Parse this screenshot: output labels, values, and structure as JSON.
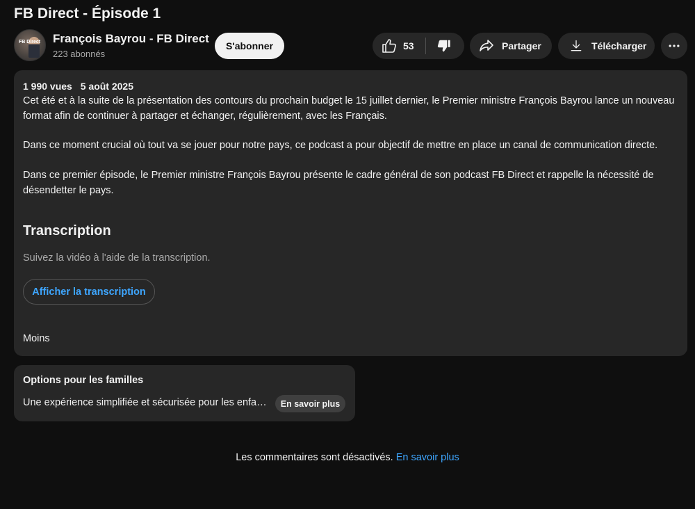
{
  "video": {
    "title": "FB Direct - Épisode 1"
  },
  "channel": {
    "avatar_text": "FB Direct",
    "name": "François Bayrou - FB Direct",
    "subscribers": "223 abonnés",
    "subscribe_label": "S'abonner"
  },
  "actions": {
    "like_count": "53",
    "share_label": "Partager",
    "download_label": "Télécharger",
    "icons": [
      "thumbs-up-icon",
      "thumbs-down-icon",
      "share-arrow-icon",
      "download-icon",
      "more-horizontal-icon"
    ]
  },
  "description": {
    "views": "1 990 vues",
    "date": "5 août 2025",
    "paragraphs": [
      "Cet été et à la suite de la présentation des contours du prochain budget le 15 juillet dernier, le Premier ministre François Bayrou lance un nouveau format afin de continuer à partager et échanger, régulièrement, avec les Français.",
      "Dans ce moment crucial où tout va se jouer pour notre pays, ce podcast a pour objectif de mettre en place un canal de communication directe.",
      "Dans ce premier épisode, le Premier ministre François Bayrou présente le cadre général de son podcast FB Direct et rappelle la nécessité de désendetter le pays."
    ],
    "transcription_title": "Transcription",
    "transcription_subtitle": "Suivez la vidéo à l'aide de la transcription.",
    "transcription_button": "Afficher la transcription",
    "less_label": "Moins"
  },
  "family": {
    "title": "Options pour les familles",
    "text": "Une expérience simplifiée et sécurisée pour les enfants",
    "button": "En savoir plus"
  },
  "comments": {
    "disabled_text": "Les commentaires sont désactivés.",
    "learn_more": "En savoir plus"
  },
  "colors": {
    "background": "#0f0f0f",
    "surface": "#272727",
    "link": "#3ea6ff",
    "text": "#f1f1f1",
    "secondary_text": "#aaaaaa"
  }
}
